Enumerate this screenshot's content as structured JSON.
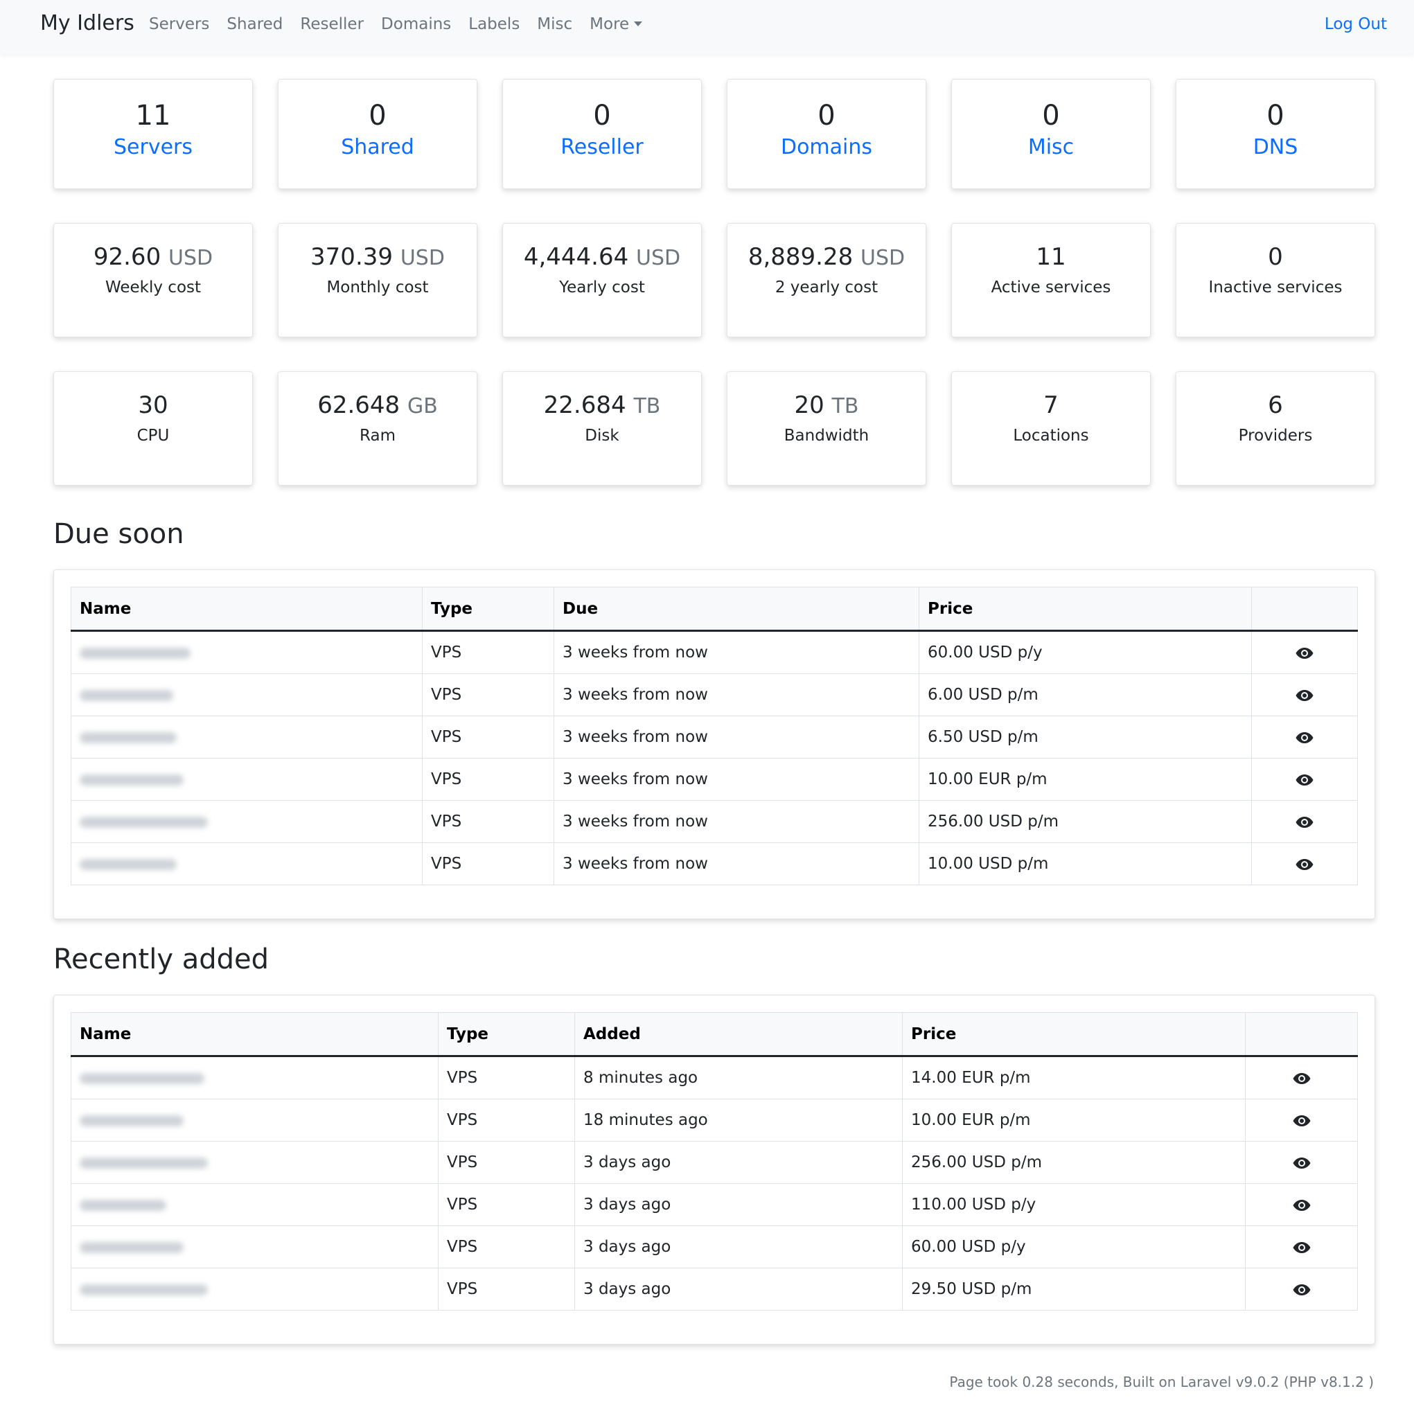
{
  "nav": {
    "brand": "My Idlers",
    "links": [
      "Servers",
      "Shared",
      "Reseller",
      "Domains",
      "Labels",
      "Misc",
      "More"
    ],
    "logout": "Log Out"
  },
  "counts": [
    {
      "value": "11",
      "label": "Servers"
    },
    {
      "value": "0",
      "label": "Shared"
    },
    {
      "value": "0",
      "label": "Reseller"
    },
    {
      "value": "0",
      "label": "Domains"
    },
    {
      "value": "0",
      "label": "Misc"
    },
    {
      "value": "0",
      "label": "DNS"
    }
  ],
  "costs": [
    {
      "value": "92.60",
      "unit": "USD",
      "label": "Weekly cost"
    },
    {
      "value": "370.39",
      "unit": "USD",
      "label": "Monthly cost"
    },
    {
      "value": "4,444.64",
      "unit": "USD",
      "label": "Yearly cost"
    },
    {
      "value": "8,889.28",
      "unit": "USD",
      "label": "2 yearly cost"
    },
    {
      "value": "11",
      "unit": "",
      "label": "Active services"
    },
    {
      "value": "0",
      "unit": "",
      "label": "Inactive services"
    }
  ],
  "resources": [
    {
      "value": "30",
      "unit": "",
      "label": "CPU"
    },
    {
      "value": "62.648",
      "unit": "GB",
      "label": "Ram"
    },
    {
      "value": "22.684",
      "unit": "TB",
      "label": "Disk"
    },
    {
      "value": "20",
      "unit": "TB",
      "label": "Bandwidth"
    },
    {
      "value": "7",
      "unit": "",
      "label": "Locations"
    },
    {
      "value": "6",
      "unit": "",
      "label": "Providers"
    }
  ],
  "due_soon": {
    "title": "Due soon",
    "headers": [
      "Name",
      "Type",
      "Due",
      "Price",
      ""
    ],
    "rows": [
      {
        "type": "VPS",
        "due": "3 weeks from now",
        "price": "60.00 USD p/y"
      },
      {
        "type": "VPS",
        "due": "3 weeks from now",
        "price": "6.00 USD p/m"
      },
      {
        "type": "VPS",
        "due": "3 weeks from now",
        "price": "6.50 USD p/m"
      },
      {
        "type": "VPS",
        "due": "3 weeks from now",
        "price": "10.00 EUR p/m"
      },
      {
        "type": "VPS",
        "due": "3 weeks from now",
        "price": "256.00 USD p/m"
      },
      {
        "type": "VPS",
        "due": "3 weeks from now",
        "price": "10.00 USD p/m"
      }
    ]
  },
  "recently_added": {
    "title": "Recently added",
    "headers": [
      "Name",
      "Type",
      "Added",
      "Price",
      ""
    ],
    "rows": [
      {
        "type": "VPS",
        "added": "8 minutes ago",
        "price": "14.00 EUR p/m"
      },
      {
        "type": "VPS",
        "added": "18 minutes ago",
        "price": "10.00 EUR p/m"
      },
      {
        "type": "VPS",
        "added": "3 days ago",
        "price": "256.00 USD p/m"
      },
      {
        "type": "VPS",
        "added": "3 days ago",
        "price": "110.00 USD p/y"
      },
      {
        "type": "VPS",
        "added": "3 days ago",
        "price": "60.00 USD p/y"
      },
      {
        "type": "VPS",
        "added": "3 days ago",
        "price": "29.50 USD p/m"
      }
    ]
  },
  "footer": "Page took 0.28 seconds, Built on Laravel v9.0.2 (PHP v8.1.2 )",
  "icons": {
    "view": "eye-icon",
    "dropdown": "caret-down-icon"
  },
  "colors": {
    "link": "#0d6efd",
    "muted": "#6c757d",
    "text": "#212529"
  }
}
